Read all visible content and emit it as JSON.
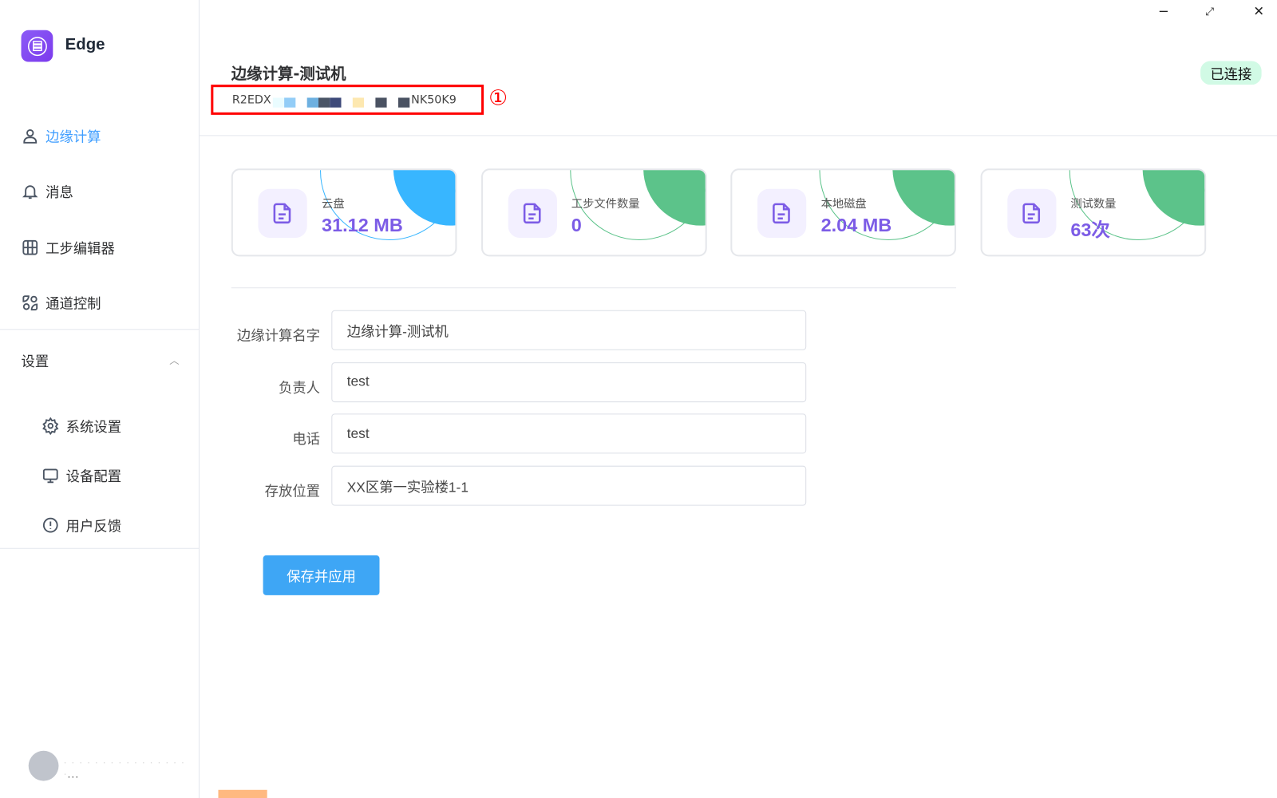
{
  "app": {
    "name": "Edge",
    "logo_color": "#8b5cf6"
  },
  "window": {
    "minimize": "−",
    "maximize": "⤢",
    "close": "✕"
  },
  "sidebar": {
    "items": [
      {
        "label": "边缘计算",
        "icon": "user-icon",
        "active": true
      },
      {
        "label": "消息",
        "icon": "bell-icon"
      },
      {
        "label": "工步编辑器",
        "icon": "grid-icon"
      },
      {
        "label": "通道控制",
        "icon": "shapes-icon"
      }
    ],
    "settings": {
      "label": "设置",
      "expanded": true,
      "items": [
        {
          "label": "系统设置",
          "icon": "gear-icon"
        },
        {
          "label": "设备配置",
          "icon": "monitor-icon"
        },
        {
          "label": "用户反馈",
          "icon": "alert-circle-icon"
        }
      ]
    },
    "user": {
      "name_suffix": "..."
    }
  },
  "header": {
    "title": "边缘计算-测试机",
    "id_prefix": "R2EDX",
    "id_suffix": "NK50K9",
    "annotation": "①",
    "status": "已连接",
    "status_color": "#d1fae5"
  },
  "cards": [
    {
      "label": "云盘",
      "value": "31.12 MB",
      "accent": "#38b6ff"
    },
    {
      "label": "工步文件数量",
      "value": "0",
      "accent": "#5cc38a"
    },
    {
      "label": "本地磁盘",
      "value": "2.04 MB",
      "accent": "#5cc38a"
    },
    {
      "label": "测试数量",
      "value": "63次",
      "accent": "#5cc38a"
    }
  ],
  "form": {
    "fields": [
      {
        "label": "边缘计算名字",
        "value": "边缘计算-测试机"
      },
      {
        "label": "负责人",
        "value": "test"
      },
      {
        "label": "电话",
        "value": "test"
      },
      {
        "label": "存放位置",
        "value": "XX区第一实验楼1-1"
      }
    ],
    "save_label": "保存并应用"
  }
}
